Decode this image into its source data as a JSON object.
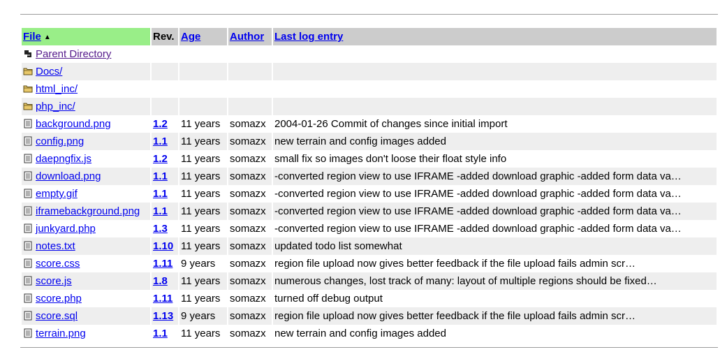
{
  "header": {
    "file": "File",
    "sort_indicator": "▲",
    "rev": "Rev.",
    "age": "Age",
    "author": "Author",
    "log": "Last log entry"
  },
  "dirs": [
    {
      "name": "Parent Directory",
      "icon": "back-arrow-icon"
    },
    {
      "name": "Docs/",
      "icon": "folder-icon"
    },
    {
      "name": "html_inc/",
      "icon": "folder-icon"
    },
    {
      "name": "php_inc/",
      "icon": "folder-icon"
    }
  ],
  "files": [
    {
      "name": "background.png",
      "rev": "1.2",
      "age": "11 years",
      "author": "somazx",
      "log": "2004-01-26 Commit of changes since initial import"
    },
    {
      "name": "config.png",
      "rev": "1.1",
      "age": "11 years",
      "author": "somazx",
      "log": "new terrain and config images added"
    },
    {
      "name": "daepngfix.js",
      "rev": "1.2",
      "age": "11 years",
      "author": "somazx",
      "log": "small fix so images don't loose their float style info"
    },
    {
      "name": "download.png",
      "rev": "1.1",
      "age": "11 years",
      "author": "somazx",
      "log": "-converted region view to use IFRAME -added download graphic -added form data va…"
    },
    {
      "name": "empty.gif",
      "rev": "1.1",
      "age": "11 years",
      "author": "somazx",
      "log": "-converted region view to use IFRAME -added download graphic -added form data va…"
    },
    {
      "name": "iframebackground.png",
      "rev": "1.1",
      "age": "11 years",
      "author": "somazx",
      "log": "-converted region view to use IFRAME -added download graphic -added form data va…"
    },
    {
      "name": "junkyard.php",
      "rev": "1.3",
      "age": "11 years",
      "author": "somazx",
      "log": "-converted region view to use IFRAME -added download graphic -added form data va…"
    },
    {
      "name": "notes.txt",
      "rev": "1.10",
      "age": "11 years",
      "author": "somazx",
      "log": "updated todo list somewhat"
    },
    {
      "name": "score.css",
      "rev": "1.11",
      "age": "9 years",
      "author": "somazx",
      "log": "region file upload now gives better feedback if the file upload fails admin scr…"
    },
    {
      "name": "score.js",
      "rev": "1.8",
      "age": "11 years",
      "author": "somazx",
      "log": "numerous changes, lost track of many: layout of multiple regions should be fixed…"
    },
    {
      "name": "score.php",
      "rev": "1.11",
      "age": "11 years",
      "author": "somazx",
      "log": "turned off debug output"
    },
    {
      "name": "score.sql",
      "rev": "1.13",
      "age": "9 years",
      "author": "somazx",
      "log": "region file upload now gives better feedback if the file upload fails admin scr…"
    },
    {
      "name": "terrain.png",
      "rev": "1.1",
      "age": "11 years",
      "author": "somazx",
      "log": "new terrain and config images added"
    }
  ],
  "colors": {
    "header_bg": "#cccccc",
    "sorted_header_bg": "#99ee88",
    "row_alt": "#eeeeee",
    "link": "#0000ee",
    "visited": "#551a8b"
  }
}
